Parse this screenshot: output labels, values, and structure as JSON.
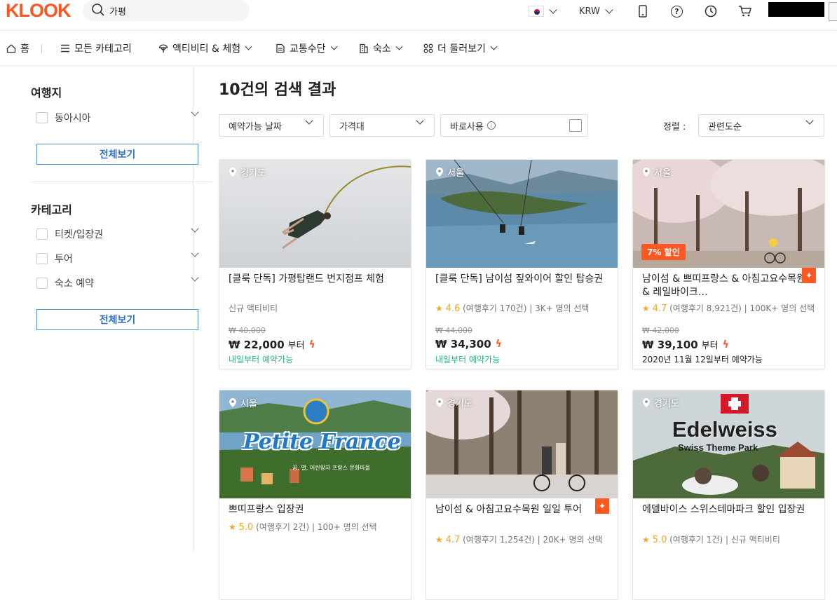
{
  "header": {
    "logo": "KLOOK",
    "search_value": "가평",
    "currency": "KRW"
  },
  "nav": {
    "home": "홈",
    "categories": "모든 카테고리",
    "activities": "액티비티 & 체험",
    "transport": "교통수단",
    "stays": "숙소",
    "more": "더 둘러보기"
  },
  "sidebar": {
    "destination_heading": "여행지",
    "destinations": [
      "동아시아"
    ],
    "view_all_1": "전체보기",
    "category_heading": "카테고리",
    "categories": [
      "티켓/입장권",
      "투어",
      "숙소 예약"
    ],
    "view_all_2": "전체보기"
  },
  "main": {
    "title": "10건의 검색 결과",
    "filters": {
      "date": "예약가능 날짜",
      "price": "가격대",
      "instant": "바로사용",
      "sort_label": "정렬 :",
      "sort_value": "관련도순"
    }
  },
  "cards": [
    {
      "location": "경기도",
      "title": "[클룩 단독] 가평탑랜드 번지점프 체험",
      "meta": "신규 액티비티",
      "old_price": "₩ 40,000",
      "price": "₩ 22,000",
      "from": "부터",
      "availability": "내일부터 예약가능"
    },
    {
      "location": "서울",
      "title": "[클룩 단독] 남이섬 짚와이어 할인 탑승권",
      "rating": "4.6",
      "reviews": "(여행후기 170건)",
      "booked": "3K+ 명의 선택",
      "old_price": "₩ 44,000",
      "price": "₩ 34,300",
      "availability": "내일부터 예약가능"
    },
    {
      "location": "서울",
      "discount": "7% 할인",
      "title": "남이섬 & 쁘띠프랑스 & 아침고요수목원 & 레일바이크…",
      "rating": "4.7",
      "reviews": "(여행후기 8,921건)",
      "booked": "100K+ 명의 선택",
      "old_price": "₩ 42,000",
      "price": "₩ 39,100",
      "from": "부터",
      "availability": "2020년 11월 12일부터 예약가능"
    },
    {
      "location": "서울",
      "title": "쁘띠프랑스 입장권",
      "rating": "5.0",
      "reviews": "(여행후기 2건)",
      "booked": "100+ 명의 선택",
      "image_text": "Petite France",
      "image_subtext": "꿈, 별, 어린왕자 프랑스 문화마을"
    },
    {
      "location": "경기도",
      "title": "남이섬 & 아침고요수목원 일일 투어",
      "rating": "4.7",
      "reviews": "(여행후기 1,254건)",
      "booked": "20K+ 명의 선택"
    },
    {
      "location": "경기도",
      "title": "에델바이스 스위스테마파크 할인 입장권",
      "rating": "5.0",
      "reviews": "(여행후기 1건)",
      "booked": "신규 액티비티",
      "image_text": "Edelweiss",
      "image_subtext": "Swiss Theme Park"
    }
  ],
  "colors": {
    "brand": "#ff5722",
    "link_blue": "#2e6fd1",
    "available_green": "#24b985",
    "star": "#f5a623"
  }
}
